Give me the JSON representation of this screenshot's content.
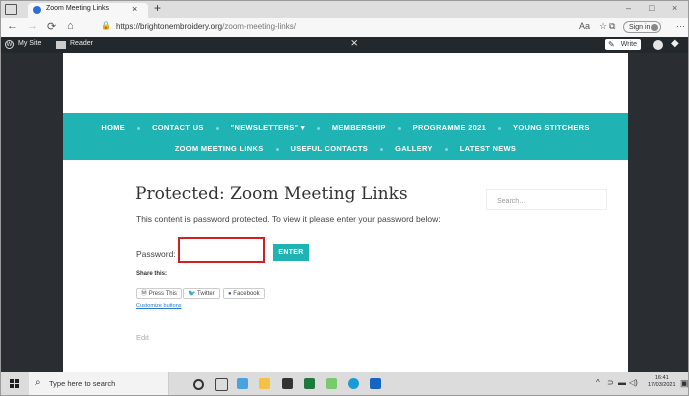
{
  "browser": {
    "tab_title": "Zoom Meeting Links",
    "tab_close": "×",
    "new_tab": "+",
    "window_controls": [
      "–",
      "□",
      "×"
    ],
    "url_host": "https://brightonembroidery.org",
    "url_path": "/zoom-meeting-links/",
    "nav_back": "←",
    "nav_forward": "→",
    "nav_refresh": "⟳",
    "nav_home": "⌂",
    "sign_in": "Sign in",
    "more": "···"
  },
  "wp_admin": {
    "my_site": "My Site",
    "reader": "Reader",
    "write": "Write"
  },
  "site_nav": {
    "row1": [
      "HOME",
      "CONTACT US",
      "\"NEWSLETTERS\" ▾",
      "MEMBERSHIP",
      "PROGRAMME 2021",
      "YOUNG STITCHERS"
    ],
    "row2": [
      "ZOOM MEETING LINKS",
      "USEFUL CONTACTS",
      "GALLERY",
      "LATEST NEWS"
    ]
  },
  "main": {
    "title": "Protected: Zoom Meeting Links",
    "message": "This content is password protected. To view it please enter your password below:",
    "password_label": "Password:",
    "password_value": "",
    "enter_button": "ENTER",
    "share_label": "Share this:",
    "share_buttons": [
      "Press This",
      "Twitter",
      "Facebook"
    ],
    "customize_link": "Customize buttons",
    "edit_link": "Edit"
  },
  "sidebar": {
    "search_placeholder": "Search…"
  },
  "taskbar": {
    "search_placeholder": "Type here to search",
    "time": "16:41",
    "date": "17/03/2021"
  },
  "colors": {
    "accent_teal": "#20b3b4",
    "admin_bar": "#23282d",
    "highlight_red": "#d02020"
  }
}
